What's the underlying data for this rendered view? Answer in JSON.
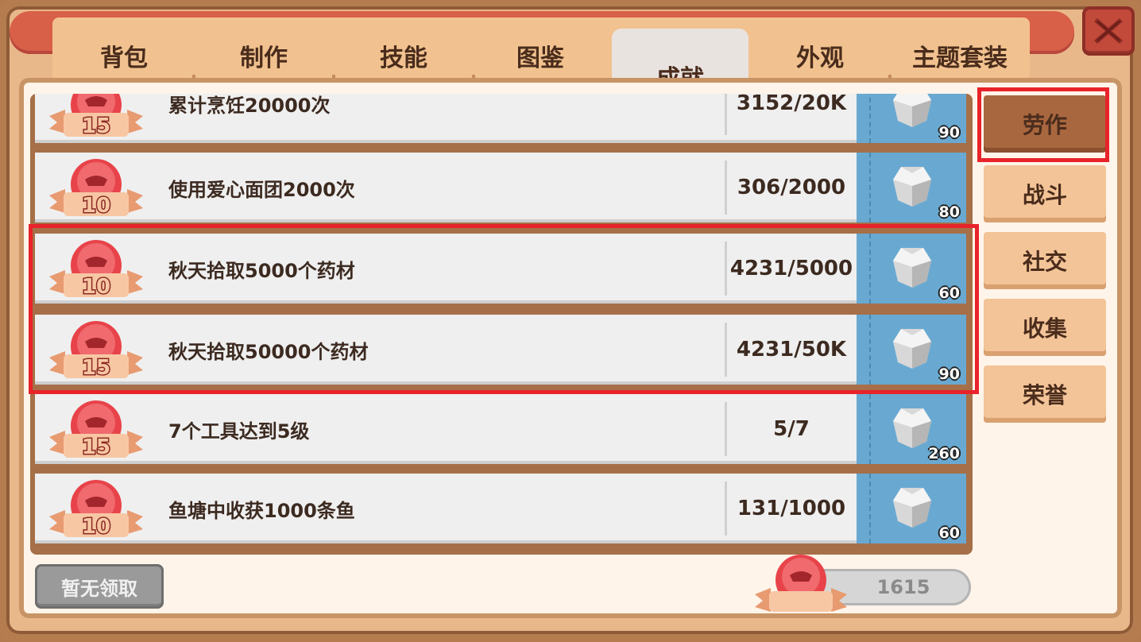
{
  "tabs": [
    {
      "label": "背包"
    },
    {
      "label": "制作"
    },
    {
      "label": "技能"
    },
    {
      "label": "图鉴"
    },
    {
      "label": "成就",
      "active": true
    },
    {
      "label": "外观"
    },
    {
      "label": "主题套装"
    }
  ],
  "categories": [
    {
      "label": "劳作",
      "active": true
    },
    {
      "label": "战斗"
    },
    {
      "label": "社交"
    },
    {
      "label": "收集"
    },
    {
      "label": "荣誉"
    }
  ],
  "achievements": [
    {
      "points": "15",
      "title": "累计烹饪20000次",
      "progress": "3152/20K",
      "reward": "90"
    },
    {
      "points": "10",
      "title": "使用爱心面团2000次",
      "progress": "306/2000",
      "reward": "80"
    },
    {
      "points": "10",
      "title": "秋天拾取5000个药材",
      "progress": "4231/5000",
      "reward": "60"
    },
    {
      "points": "15",
      "title": "秋天拾取50000个药材",
      "progress": "4231/50K",
      "reward": "90"
    },
    {
      "points": "15",
      "title": "7个工具达到5级",
      "progress": "5/7",
      "reward": "260"
    },
    {
      "points": "10",
      "title": "鱼塘中收获1000条鱼",
      "progress": "131/1000",
      "reward": "60"
    }
  ],
  "footer": {
    "claim_label": "暂无领取",
    "total_points": "1615"
  },
  "colors": {
    "highlight": "#e8232a",
    "reward_bg": "#69a9d1",
    "active_category": "#a9673f"
  },
  "icons": {
    "close": "close-x-icon",
    "badge": "medal-badge-icon",
    "reward": "silver-gem-icon"
  }
}
